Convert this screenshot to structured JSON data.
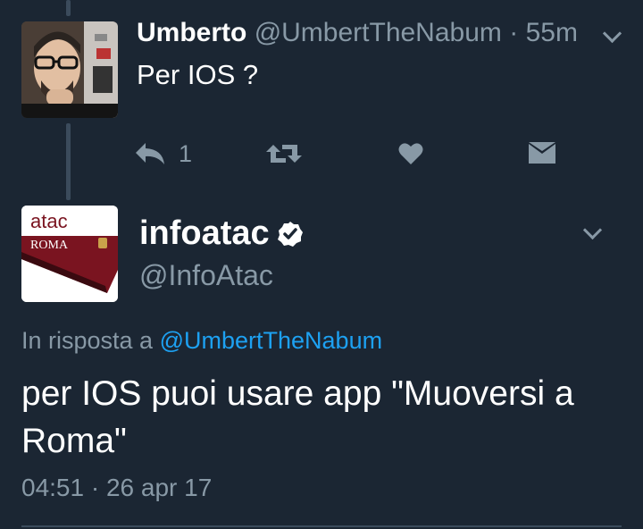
{
  "tweet1": {
    "author_name": "Umberto",
    "author_handle": "@UmbertTheNabum",
    "separator": "·",
    "time": "55m",
    "text": "Per IOS ?",
    "reply_count": "1"
  },
  "tweet2": {
    "author_name": "infoatac",
    "author_handle": "@InfoAtac",
    "reply_prefix": "In risposta a",
    "reply_handle": "@UmbertTheNabum",
    "text": "per IOS puoi usare app \"Muoversi a Roma\"",
    "timestamp": "04:51 · 26 apr 17",
    "logo_text_top": "atac",
    "logo_text_sub": "ROMA"
  },
  "colors": {
    "background": "#1b2633",
    "muted": "#8899a6",
    "link": "#1da1f2",
    "thread_line": "#3b4b5c",
    "atac_red": "#7a1420"
  },
  "icons": [
    "chevron-down-icon",
    "reply-icon",
    "retweet-icon",
    "heart-icon",
    "direct-message-icon",
    "verified-badge-icon"
  ]
}
